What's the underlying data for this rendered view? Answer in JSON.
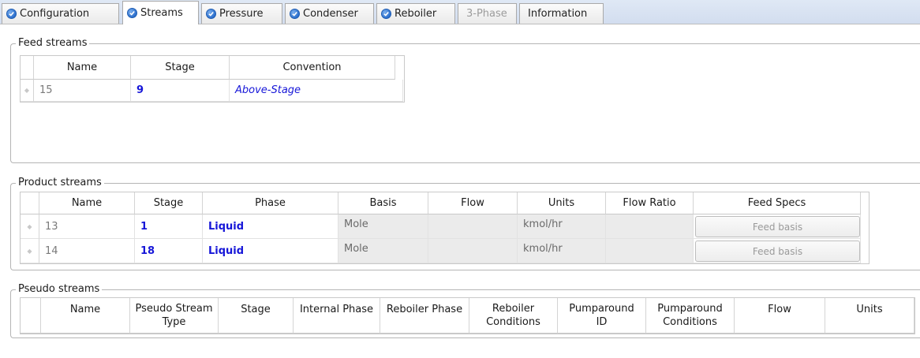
{
  "tabs": [
    {
      "label": "Configuration",
      "checked": true,
      "active": false,
      "disabled": false
    },
    {
      "label": "Streams",
      "checked": true,
      "active": true,
      "disabled": false
    },
    {
      "label": "Pressure",
      "checked": true,
      "active": false,
      "disabled": false
    },
    {
      "label": "Condenser",
      "checked": true,
      "active": false,
      "disabled": false
    },
    {
      "label": "Reboiler",
      "checked": true,
      "active": false,
      "disabled": false
    },
    {
      "label": "3-Phase",
      "checked": false,
      "active": false,
      "disabled": true
    },
    {
      "label": "Information",
      "checked": false,
      "active": false,
      "disabled": false
    }
  ],
  "feed": {
    "legend": "Feed streams",
    "headers": [
      "Name",
      "Stage",
      "Convention"
    ],
    "rows": [
      {
        "name": "15",
        "stage": "9",
        "convention": "Above-Stage"
      }
    ]
  },
  "product": {
    "legend": "Product streams",
    "headers": [
      "Name",
      "Stage",
      "Phase",
      "Basis",
      "Flow",
      "Units",
      "Flow Ratio",
      "Feed Specs"
    ],
    "rows": [
      {
        "name": "13",
        "stage": "1",
        "phase": "Liquid",
        "basis": "Mole",
        "flow": "",
        "units": "kmol/hr",
        "flow_ratio": "",
        "feed_specs": "Feed basis"
      },
      {
        "name": "14",
        "stage": "18",
        "phase": "Liquid",
        "basis": "Mole",
        "flow": "",
        "units": "kmol/hr",
        "flow_ratio": "",
        "feed_specs": "Feed basis"
      }
    ]
  },
  "pseudo": {
    "legend": "Pseudo streams",
    "headers": [
      "Name",
      "Pseudo Stream Type",
      "Stage",
      "Internal Phase",
      "Reboiler Phase",
      "Reboiler Conditions",
      "Pumparound ID",
      "Pumparound Conditions",
      "Flow",
      "Units"
    ],
    "header_lines": [
      [
        "Name"
      ],
      [
        "Pseudo Stream",
        "Type"
      ],
      [
        "Stage"
      ],
      [
        "Internal Phase"
      ],
      [
        "Reboiler Phase"
      ],
      [
        "Reboiler",
        "Conditions"
      ],
      [
        "Pumparound",
        "ID"
      ],
      [
        "Pumparound",
        "Conditions"
      ],
      [
        "Flow"
      ],
      [
        "Units"
      ]
    ]
  },
  "colors": {
    "accent_blue": "#1616d8",
    "tabbar": "#d2ddef"
  }
}
